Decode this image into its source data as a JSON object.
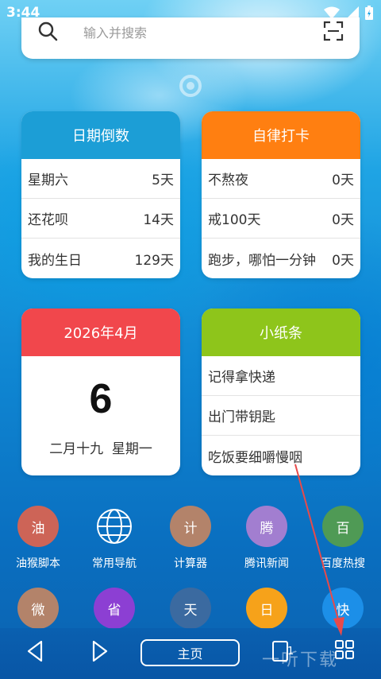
{
  "status_bar": {
    "time": "3:44"
  },
  "search": {
    "placeholder": "输入并搜索"
  },
  "countdown": {
    "title": "日期倒数",
    "color": "#1c9ed6",
    "items": [
      {
        "name": "星期六",
        "value": "5天"
      },
      {
        "name": "还花呗",
        "value": "14天"
      },
      {
        "name": "我的生日",
        "value": "129天"
      }
    ]
  },
  "checkin": {
    "title": "自律打卡",
    "color": "#ff7f11",
    "items": [
      {
        "name": "不熬夜",
        "value": "0天"
      },
      {
        "name": "戒100天",
        "value": "0天"
      },
      {
        "name": "跑步，哪怕一分钟",
        "value": "0天"
      }
    ]
  },
  "calendar": {
    "title": "2026年4月",
    "color": "#f1474c",
    "day": "6",
    "lunar": "二月十九",
    "weekday": "星期一"
  },
  "notes": {
    "title": "小纸条",
    "color": "#8ec51b",
    "items": [
      "记得拿快递",
      "出门带钥匙",
      "吃饭要细嚼慢咽"
    ]
  },
  "apps_row1": [
    {
      "glyph": "油",
      "label": "油猴脚本",
      "color": "#cd6457",
      "icon": "oil-icon"
    },
    {
      "glyph": "",
      "label": "常用导航",
      "color": "transparent",
      "icon": "globe-icon"
    },
    {
      "glyph": "计",
      "label": "计算器",
      "color": "#b3836a",
      "icon": "calculator-icon"
    },
    {
      "glyph": "腾",
      "label": "腾讯新闻",
      "color": "#a27ed0",
      "icon": "tencent-icon"
    },
    {
      "glyph": "百",
      "label": "百度热搜",
      "color": "#4f9a55",
      "icon": "baidu-icon"
    }
  ],
  "apps_row2": [
    {
      "glyph": "微",
      "color": "#b3836a",
      "icon": "weibo-icon"
    },
    {
      "glyph": "省",
      "color": "#8c3fd3",
      "icon": "save-icon"
    },
    {
      "glyph": "天",
      "color": "#3b6aa0",
      "icon": "weather-icon"
    },
    {
      "glyph": "日",
      "color": "#f6a21a",
      "icon": "daily-icon"
    },
    {
      "glyph": "快",
      "color": "#1c8fe8",
      "icon": "kuai-icon"
    }
  ],
  "nav": {
    "home_label": "主页",
    "tab_count": "1"
  },
  "watermark": "一听下载"
}
